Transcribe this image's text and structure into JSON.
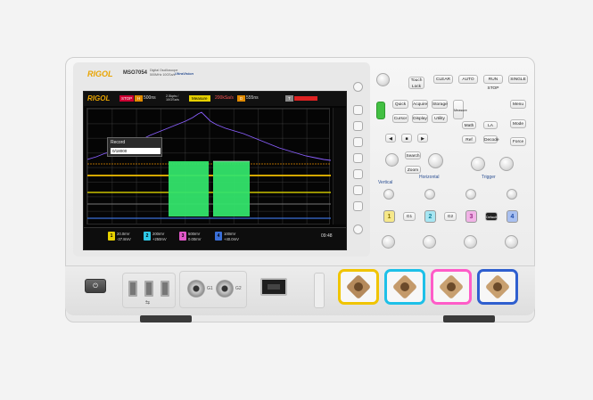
{
  "brand": {
    "logo": "RIGOL",
    "model": "MSO7054",
    "subtitle_1": "Digital Oscilloscope",
    "subtitle_2": "500MHz 10GSa/s",
    "series_badge": "UltraVision"
  },
  "screen": {
    "logo": "RIGOL",
    "status": "STOP",
    "h_label": "H",
    "timebase": "500ns",
    "samples": "2.5kpts / 10GSa/s",
    "measure_tab": "Measure",
    "mode": "200kSa/s",
    "d_label": "D",
    "delay": "555ns",
    "t_label": "T",
    "dialog": {
      "title": "Record",
      "field_value": "0/18000"
    },
    "bottom": {
      "ch1": {
        "num": "1",
        "line1": "20.0mV",
        "line2": "-37.8mV"
      },
      "ch2": {
        "num": "2",
        "line1": "200mV",
        "line2": "+250mV"
      },
      "ch3": {
        "num": "3",
        "line1": "500mV",
        "line2": "0.00mV"
      },
      "ch4": {
        "num": "4",
        "line1": "100mV",
        "line2": "+40.0mV"
      },
      "time": "09:48"
    }
  },
  "panel": {
    "top_buttons": [
      "CLEAR",
      "AUTO",
      "RUN STOP",
      "SINGLE"
    ],
    "touch_lock": "Touch Lock",
    "row1": [
      "Quick",
      "Acquire",
      "Storage"
    ],
    "row2": [
      "Cursor",
      "Display",
      "Utility"
    ],
    "row3": [
      "Measure"
    ],
    "right_col": [
      "Menu",
      "Mode",
      "Force"
    ],
    "la_row": [
      "Math",
      "LA"
    ],
    "ref_row": [
      "Ref",
      "Decode"
    ],
    "nav": [
      "Search",
      "Zoom"
    ],
    "labels": {
      "horizontal": "Horizontal",
      "vertical": "Vertical",
      "trigger": "Trigger"
    },
    "channels": [
      {
        "num": "1",
        "color": "#e6d000"
      },
      {
        "num": "2",
        "color": "#2ec7e6"
      },
      {
        "num": "3",
        "color": "#e057c8"
      },
      {
        "num": "4",
        "color": "#3a6fd8"
      }
    ],
    "channel_buttons": [
      "G1",
      "G2",
      "Default"
    ]
  },
  "front": {
    "usb_symbol": "⇆",
    "gen_labels": [
      "G1",
      "G2"
    ],
    "colors": {
      "ch1": "#f0c400",
      "ch2": "#1ec0e8",
      "ch3": "#ff5cc8",
      "ch4": "#2f5fcf"
    }
  }
}
